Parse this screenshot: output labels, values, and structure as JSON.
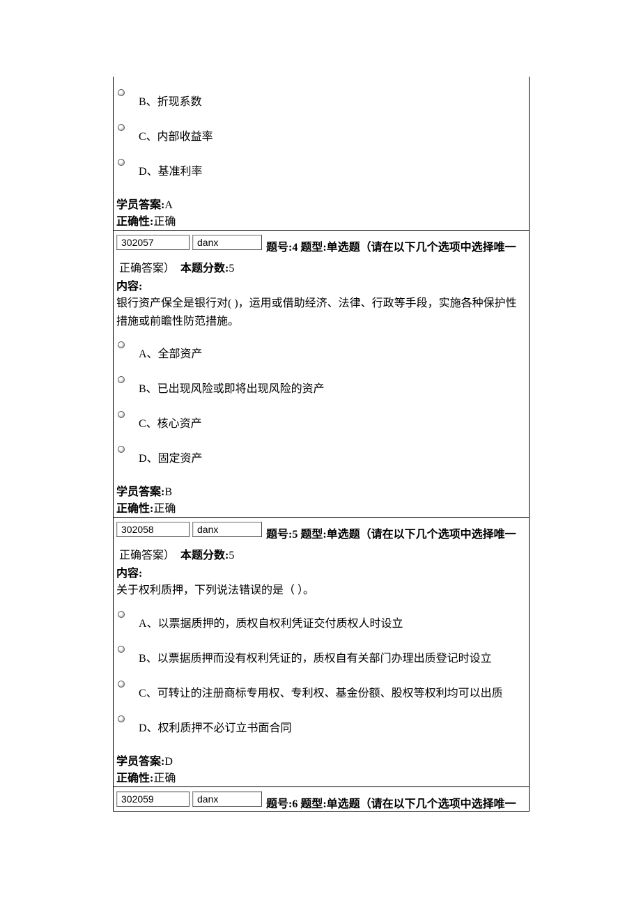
{
  "q3_tail": {
    "options": [
      "B、折现系数",
      "C、内部收益率",
      "D、基准利率"
    ],
    "student_answer_label": "学员答案:",
    "student_answer_value": "A",
    "correct_label": "正确性:",
    "correct_value": "正确"
  },
  "q4": {
    "input_id": "302057",
    "input_type": "danx",
    "meta": "题号:4 题型:单选题（请在以下几个选项中选择唯一",
    "meta_cont": "正确答案）  本题分数:5",
    "content_label": "内容:",
    "content_text": "银行资产保全是银行对( )，运用或借助经济、法律、行政等手段，实施各种保护性措施或前瞻性防范措施。",
    "options": [
      "A、全部资产",
      "B、已出现风险或即将出现风险的资产",
      "C、核心资产",
      "D、固定资产"
    ],
    "student_answer_label": "学员答案:",
    "student_answer_value": "B",
    "correct_label": "正确性:",
    "correct_value": "正确"
  },
  "q5": {
    "input_id": "302058",
    "input_type": "danx",
    "meta": "题号:5 题型:单选题（请在以下几个选项中选择唯一",
    "meta_cont": "正确答案）  本题分数:5",
    "content_label": "内容:",
    "content_text": "关于权利质押，下列说法错误的是（ ）。",
    "options": [
      "A、以票据质押的，质权自权利凭证交付质权人时设立",
      "B、以票据质押而没有权利凭证的，质权自有关部门办理出质登记时设立",
      "C、可转让的注册商标专用权、专利权、基金份额、股权等权利均可以出质",
      "D、权利质押不必订立书面合同"
    ],
    "student_answer_label": "学员答案:",
    "student_answer_value": "D",
    "correct_label": "正确性:",
    "correct_value": "正确"
  },
  "q6": {
    "input_id": "302059",
    "input_type": "danx",
    "meta": "题号:6 题型:单选题（请在以下几个选项中选择唯一"
  }
}
